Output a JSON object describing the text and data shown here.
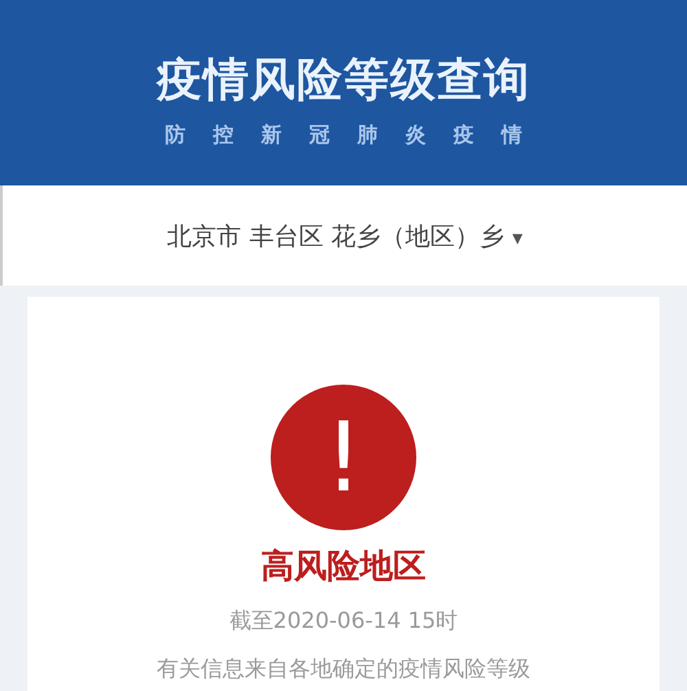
{
  "header": {
    "title": "疫情风险等级查询",
    "subtitle": [
      "防",
      "控",
      "新",
      "冠",
      "肺",
      "炎",
      "疫",
      "情"
    ]
  },
  "location": {
    "text": "北京市 丰台区 花乡（地区）乡",
    "caret": "▾"
  },
  "result": {
    "kind": "high",
    "symbol": "!",
    "label": "高风险地区",
    "updated": "截至2020-06-14 15时",
    "note": "有关信息来自各地确定的疫情风险等级"
  }
}
